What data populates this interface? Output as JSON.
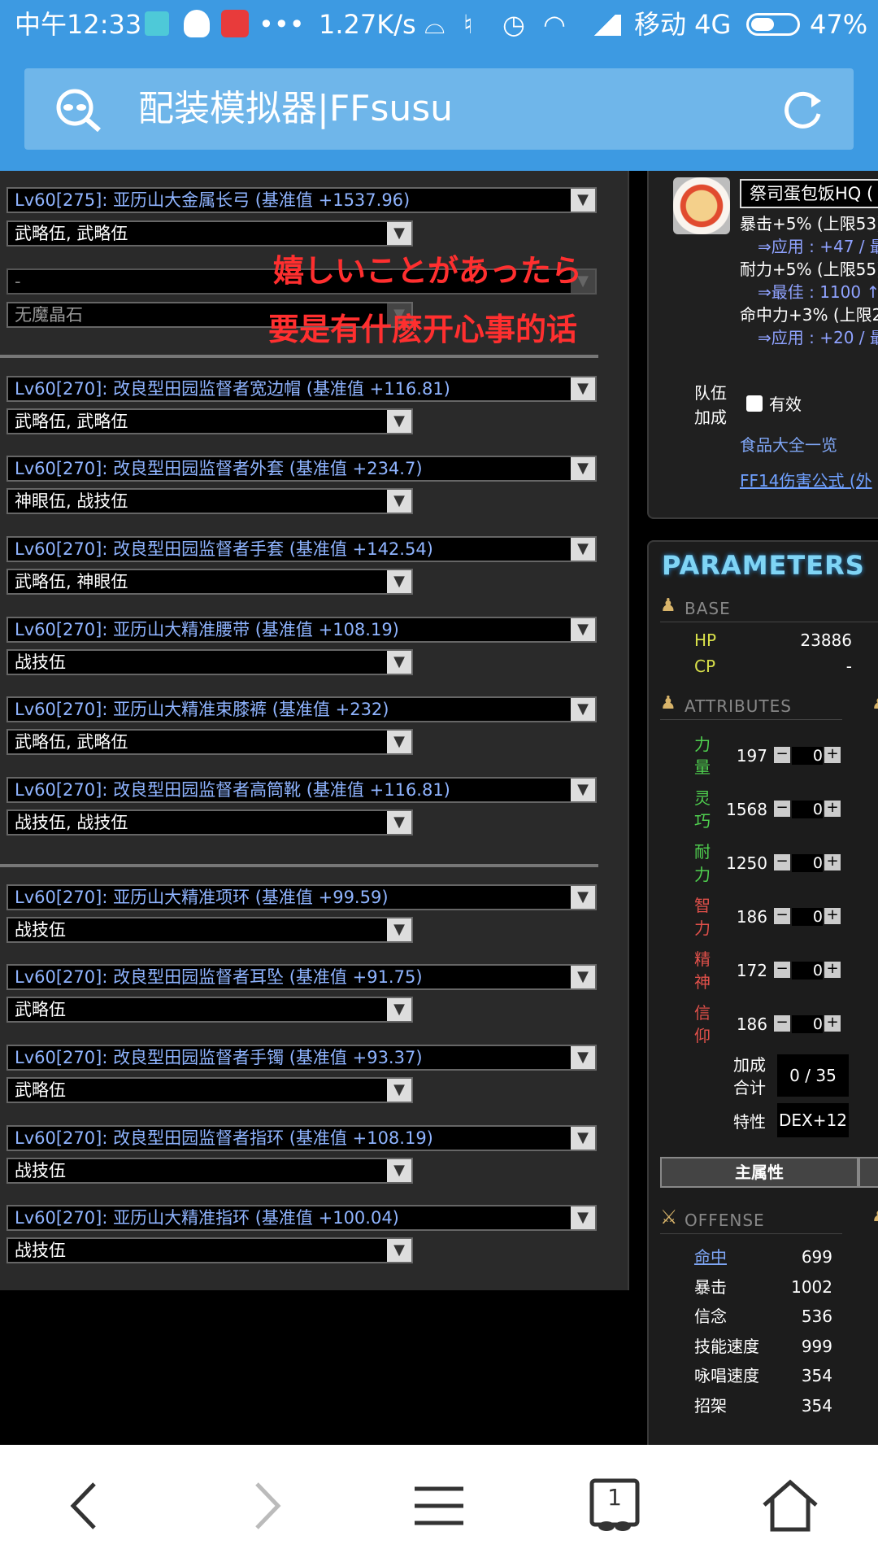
{
  "status_bar": {
    "time": "中午12:33",
    "speed": "1.27K/s",
    "carrier": "移动 4G",
    "battery": "47%"
  },
  "url_bar": {
    "title": "配装模拟器|FFsusu"
  },
  "overlay_text": {
    "line1": "嬉しいことがあったら",
    "line2": "要是有什麽开心事的话"
  },
  "gear": [
    {
      "item": "Lv60[275]: 亚历山大金属长弓 (基准值 +1537.96)",
      "materia": "武略伍, 武略伍"
    },
    {
      "item": "-",
      "materia": "无魔晶石"
    },
    {
      "item": "Lv60[270]: 改良型田园监督者宽边帽 (基准值 +116.81)",
      "materia": "武略伍, 武略伍"
    },
    {
      "item": "Lv60[270]: 改良型田园监督者外套 (基准值 +234.7)",
      "materia": "神眼伍, 战技伍"
    },
    {
      "item": "Lv60[270]: 改良型田园监督者手套 (基准值 +142.54)",
      "materia": "武略伍, 神眼伍"
    },
    {
      "item": "Lv60[270]: 亚历山大精准腰带 (基准值 +108.19)",
      "materia": "战技伍"
    },
    {
      "item": "Lv60[270]: 亚历山大精准束膝裤 (基准值 +232)",
      "materia": "武略伍, 武略伍"
    },
    {
      "item": "Lv60[270]: 改良型田园监督者高筒靴 (基准值 +116.81)",
      "materia": "战技伍, 战技伍"
    },
    {
      "item": "Lv60[270]: 亚历山大精准项环 (基准值 +99.59)",
      "materia": "战技伍"
    },
    {
      "item": "Lv60[270]: 改良型田园监督者耳坠 (基准值 +91.75)",
      "materia": "武略伍"
    },
    {
      "item": "Lv60[270]: 改良型田园监督者手镯 (基准值 +93.37)",
      "materia": "武略伍"
    },
    {
      "item": "Lv60[270]: 改良型田园监督者指环 (基准值 +108.19)",
      "materia": "战技伍"
    },
    {
      "item": "Lv60[270]: 亚历山大精准指环 (基准值 +100.04)",
      "materia": "战技伍"
    }
  ],
  "food": {
    "name": "祭司蛋包饭HQ (",
    "l1": "暴击+5% (上限53)",
    "l2": "⇒应用 : +47 / 最",
    "l3": "耐力+5% (上限55)",
    "l4": "⇒最佳 : 1100 ↑",
    "l5": "命中力+3% (上限2",
    "l6": "⇒应用 : +20 / 最",
    "party_label_1": "队伍",
    "party_label_2": "加成",
    "party_checkbox": "有效",
    "food_list_link": "食品大全一览",
    "damage_link": "FF14伤害公式 (外"
  },
  "params": {
    "title": "PARAMETERS",
    "base_header": "BASE",
    "hp_label": "HP",
    "hp_value": "23886",
    "cp_label": "CP",
    "cp_value": "-",
    "attr_header": "ATTRIBUTES",
    "attributes": [
      {
        "c1": "力",
        "c2": "量",
        "value": "197",
        "add": "0",
        "color": "#4fd04f"
      },
      {
        "c1": "灵",
        "c2": "巧",
        "value": "1568",
        "add": "0",
        "color": "#4fd04f"
      },
      {
        "c1": "耐",
        "c2": "力",
        "value": "1250",
        "add": "0",
        "color": "#4fd04f"
      },
      {
        "c1": "智",
        "c2": "力",
        "value": "186",
        "add": "0",
        "color": "#e0504a"
      },
      {
        "c1": "精",
        "c2": "神",
        "value": "172",
        "add": "0",
        "color": "#e0504a"
      },
      {
        "c1": "信",
        "c2": "仰",
        "value": "186",
        "add": "0",
        "color": "#e0504a"
      }
    ],
    "bonus_label_1": "加成",
    "bonus_label_2": "合计",
    "bonus_value": "0 / 35",
    "trait_label": "特性",
    "trait_value": "DEX+12",
    "main_attr_tab": "主属性",
    "offense_header": "OFFENSE",
    "offense": [
      {
        "label": "命中",
        "value": "699"
      },
      {
        "label": "暴击",
        "value": "1002"
      },
      {
        "label": "信念",
        "value": "536"
      },
      {
        "label": "技能速度",
        "value": "999"
      },
      {
        "label": "咏唱速度",
        "value": "354"
      },
      {
        "label": "招架",
        "value": "354"
      }
    ]
  },
  "nav": {
    "tab_count": "1"
  }
}
